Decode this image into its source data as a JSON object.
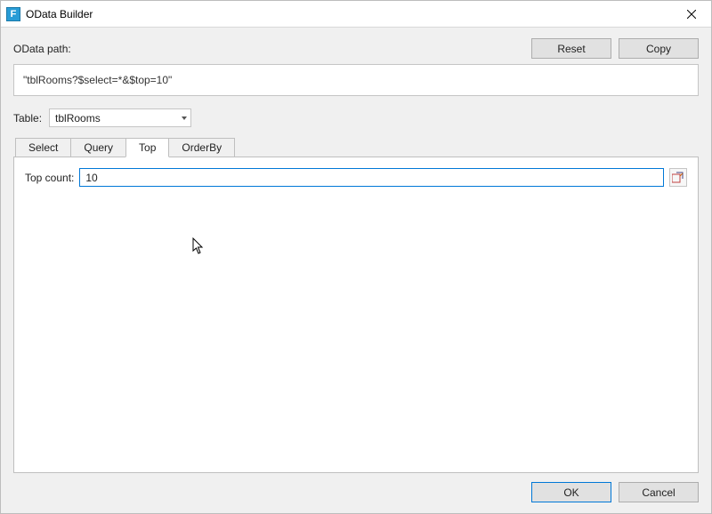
{
  "window": {
    "title": "OData Builder",
    "app_icon_letter": "F"
  },
  "toolbar": {
    "odata_path_label": "OData path:",
    "reset_label": "Reset",
    "copy_label": "Copy"
  },
  "odata": {
    "expression": "\"tblRooms?$select=*&$top=10\""
  },
  "table": {
    "label": "Table:",
    "selected": "tblRooms"
  },
  "tabs": {
    "items": [
      "Select",
      "Query",
      "Top",
      "OrderBy"
    ],
    "active_index": 2
  },
  "top_tab": {
    "label": "Top count:",
    "value": "10"
  },
  "footer": {
    "ok_label": "OK",
    "cancel_label": "Cancel"
  }
}
